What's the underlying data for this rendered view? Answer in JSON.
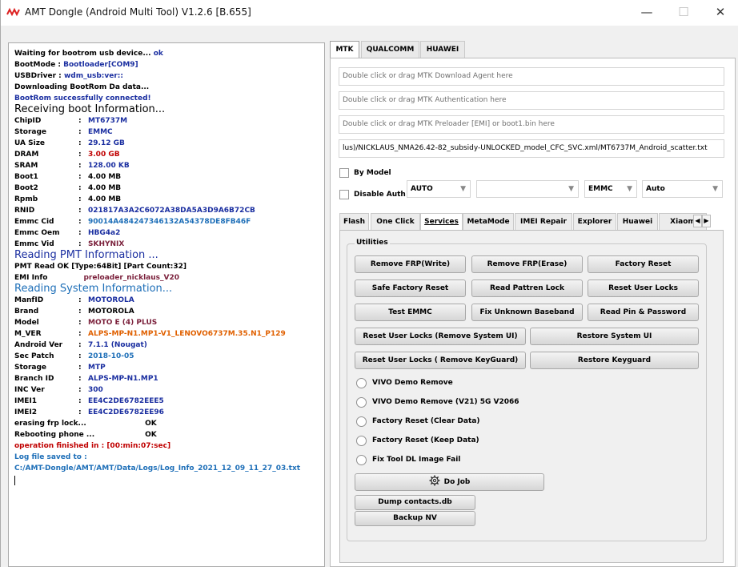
{
  "window": {
    "title": "AMT Dongle (Android Multi Tool) V1.2.6 [B.655]",
    "app_icon": "amt-logo-icon",
    "minimize": "—",
    "maximize": "☐",
    "close": "✕"
  },
  "log": [
    {
      "t": "Waiting for bootrom usb device...",
      "v": "ok",
      "vc": "cb"
    },
    {
      "t": "BootMode :",
      "v": "Bootloader[COM9]",
      "vc": "cb"
    },
    {
      "t": "USBDriver :",
      "v": "wdm_usb:ver::",
      "vc": "cb"
    },
    {
      "t": "Downloading BootRom Da data...",
      "v": "",
      "vc": ""
    },
    {
      "t": "BootRom successfully connected!",
      "v": "",
      "vc": "",
      "tc": "cb"
    },
    {
      "t": "Receiving boot Information...",
      "big": true
    },
    {
      "k": "ChipID",
      "v": "MT6737M",
      "vc": "cb"
    },
    {
      "k": "Storage",
      "v": "EMMC",
      "vc": "cb"
    },
    {
      "k": "UA Size",
      "v": "29.12 GB",
      "vc": "cb"
    },
    {
      "k": "DRAM",
      "v": "3.00 GB",
      "vc": "cr"
    },
    {
      "k": "SRAM",
      "v": "128.00 KB",
      "vc": "cb"
    },
    {
      "k": "Boot1",
      "v": "4.00 MB",
      "vc": "cx"
    },
    {
      "k": "Boot2",
      "v": "4.00 MB",
      "vc": "cx"
    },
    {
      "k": "Rpmb",
      "v": "4.00 MB",
      "vc": "cx"
    },
    {
      "k": "RNID",
      "v": "021817A3A2C6072A38DA5A3D9A6B72CB",
      "vc": "cb"
    },
    {
      "k": "Emmc Cid",
      "v": "90014A484247346132A54378DE8FB46F",
      "vc": "cl"
    },
    {
      "k": "Emmc Oem",
      "v": "HBG4a2",
      "vc": "cb"
    },
    {
      "k": "Emmc Vid",
      "v": "SKHYNIX",
      "vc": "cp"
    },
    {
      "t": "Reading PMT Information ...",
      "big": true,
      "tc": "cb"
    },
    {
      "t": "PMT Read OK [Type:64Bit] [Part Count:32]",
      "v": "",
      "vc": ""
    },
    {
      "t": "EMI Info",
      "v": "preloader_nicklaus_V20",
      "vc": "cp",
      "emi": true
    },
    {
      "t": "Reading System Information...",
      "big": true,
      "tc": "cl"
    },
    {
      "k": "ManfID",
      "v": "MOTOROLA",
      "vc": "cb"
    },
    {
      "k": "Brand",
      "v": "MOTOROLA",
      "vc": "cx"
    },
    {
      "k": "Model",
      "v": "MOTO E (4) PLUS",
      "vc": "cp"
    },
    {
      "k": "M_VER",
      "v": "ALPS-MP-N1.MP1-V1_LENOVO6737M.35.N1_P129",
      "vc": "co"
    },
    {
      "k": "Android Ver",
      "v": "7.1.1 (Nougat)",
      "vc": "cb"
    },
    {
      "k": "Sec Patch",
      "v": "2018-10-05",
      "vc": "cl"
    },
    {
      "k": "Storage",
      "v": "MTP",
      "vc": "cb"
    },
    {
      "k": "Branch ID",
      "v": "ALPS-MP-N1.MP1",
      "vc": "cb"
    },
    {
      "k": "INC Ver",
      "v": "300",
      "vc": "cb"
    },
    {
      "k": "IMEI1",
      "v": "EE4C2DE6782EEE5",
      "vc": "cb"
    },
    {
      "k": "IMEI2",
      "v": "EE4C2DE6782EE96",
      "vc": "cb"
    },
    {
      "t": "erasing frp lock...",
      "v": "OK",
      "vc": "cx",
      "ok": true
    },
    {
      "t": "Rebooting phone ...",
      "v": "OK",
      "vc": "cx",
      "ok": true
    },
    {
      "t": "operation finished in : [00:min:07:sec]",
      "v": "",
      "vc": "",
      "tc": "cr"
    },
    {
      "t": "Log file saved to :",
      "v": "",
      "vc": "",
      "tc": "cl"
    },
    {
      "t": "C:/AMT-Dongle/AMT/AMT/Data/Logs/Log_Info_2021_12_09_11_27_03.txt",
      "v": "",
      "vc": "",
      "tc": "cl"
    }
  ],
  "top_tabs": {
    "mtk": "MTK",
    "qualcomm": "QUALCOMM",
    "huawei": "HUAWEI",
    "selected": "MTK"
  },
  "fields": {
    "da_placeholder": "Double click or drag MTK Download Agent here",
    "auth_placeholder": "Double click or drag MTK Authentication here",
    "preloader_placeholder": "Double click or drag MTK Preloader [EMI] or boot1.bin here",
    "scatter_value": "lus)/NICKLAUS_NMA26.42-82_subsidy-UNLOCKED_model_CFC_SVC.xml/MT6737M_Android_scatter.txt"
  },
  "options": {
    "by_model": "By Model",
    "by_model_checked": false,
    "auto_combo": "AUTO",
    "model_combo": "",
    "storage_combo": "EMMC",
    "auto2_combo": "Auto",
    "disable_auth": "Disable Auth",
    "disable_auth_checked": false
  },
  "sub_tabs": [
    "Flash",
    "One Click",
    "Services",
    "MetaMode",
    "IMEI Repair",
    "Explorer",
    "Huawei",
    "Xiaom"
  ],
  "selected_sub_tab": "Services",
  "utilities": {
    "title": "Utilities",
    "buttons": {
      "remove_frp_write": "Remove FRP(Write)",
      "remove_frp_erase": "Remove FRP(Erase)",
      "factory_reset": "Factory Reset",
      "safe_factory_reset": "Safe Factory Reset",
      "read_pattren_lock": "Read Pattren Lock",
      "reset_user_locks": "Reset User Locks",
      "test_emmc": "Test EMMC",
      "fix_unknown_baseband": "Fix Unknown Baseband",
      "read_pin_password": "Read Pin & Password",
      "reset_user_locks_sysui": "Reset User Locks (Remove System UI)",
      "restore_system_ui": "Restore System UI",
      "reset_user_locks_keyguard": "Reset User Locks ( Remove KeyGuard)",
      "restore_keyguard": "Restore Keyguard"
    },
    "radios": {
      "vivo_demo": "VIVO Demo Remove",
      "vivo_demo_v21": "VIVO Demo Remove (V21) 5G V2066",
      "factory_reset_clear": "Factory Reset (Clear Data)",
      "factory_reset_keep": "Factory Reset (Keep Data)",
      "fix_tool_dl": "Fix Tool DL Image Fail"
    },
    "do_job": "Do Job",
    "dump_contacts": "Dump contacts.db",
    "backup_nv": "Backup NV"
  }
}
